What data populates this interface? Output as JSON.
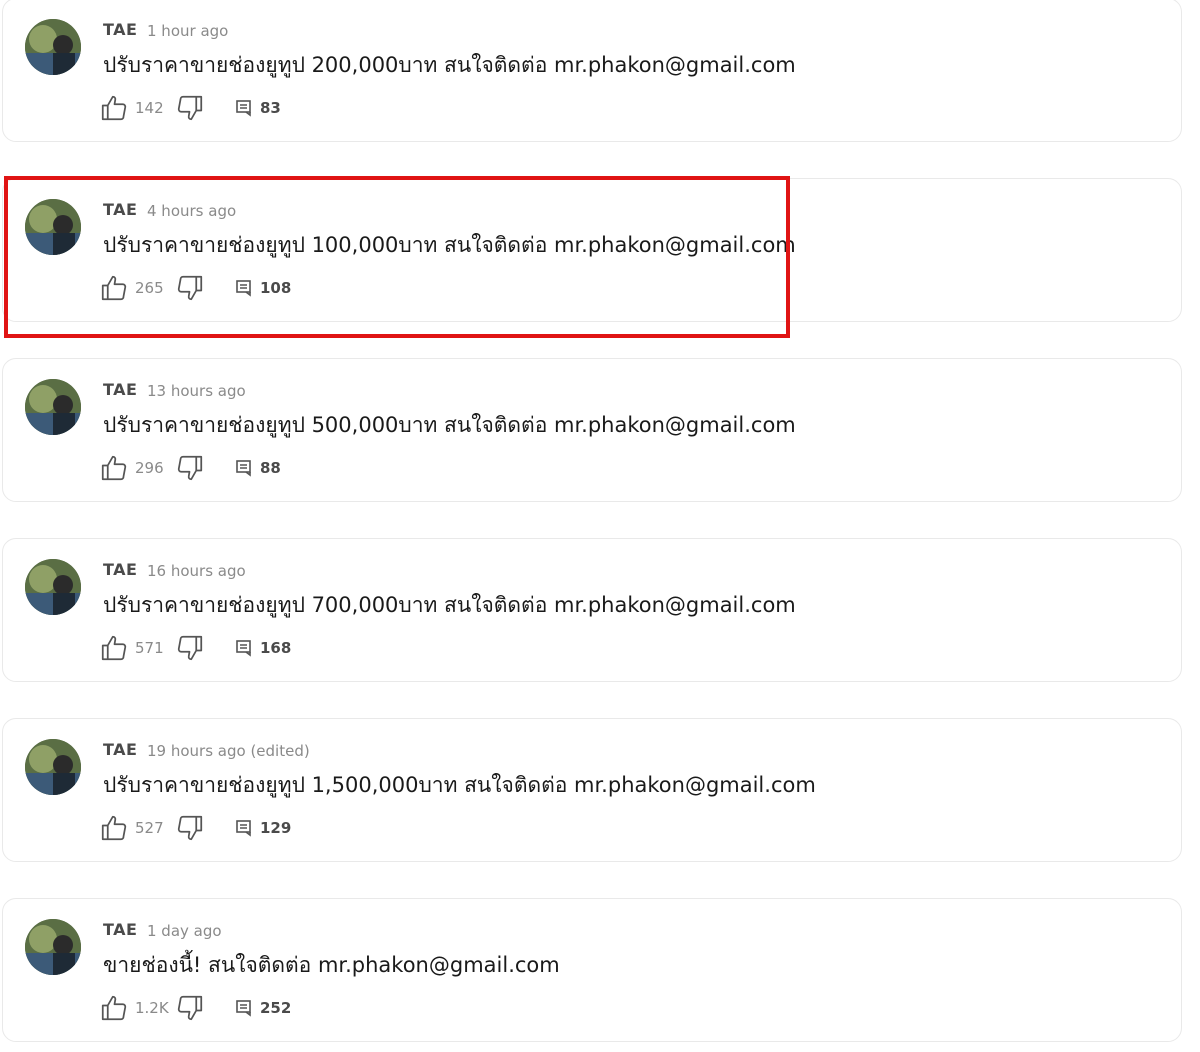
{
  "colors": {
    "highlight": "#e01414",
    "card_border": "#e9e9e9",
    "meta_text": "#8a8a8a"
  },
  "comments": [
    {
      "author": "TAE",
      "time": "1 hour ago",
      "text": "ปรับราคาขายช่องยูทูป 200,000บาท สนใจติดต่อ mr.phakon@gmail.com",
      "likes": "142",
      "replies": "83"
    },
    {
      "author": "TAE",
      "time": "4 hours ago",
      "text": "ปรับราคาขายช่องยูทูป 100,000บาท สนใจติดต่อ mr.phakon@gmail.com",
      "likes": "265",
      "replies": "108"
    },
    {
      "author": "TAE",
      "time": "13 hours ago",
      "text": "ปรับราคาขายช่องยูทูป 500,000บาท สนใจติดต่อ mr.phakon@gmail.com",
      "likes": "296",
      "replies": "88"
    },
    {
      "author": "TAE",
      "time": "16 hours ago",
      "text": "ปรับราคาขายช่องยูทูป 700,000บาท สนใจติดต่อ mr.phakon@gmail.com",
      "likes": "571",
      "replies": "168"
    },
    {
      "author": "TAE",
      "time": "19 hours ago (edited)",
      "text": "ปรับราคาขายช่องยูทูป 1,500,000บาท สนใจติดต่อ mr.phakon@gmail.com",
      "likes": "527",
      "replies": "129"
    },
    {
      "author": "TAE",
      "time": "1 day ago",
      "text": "ขายช่องนี้! สนใจติดต่อ mr.phakon@gmail.com",
      "likes": "1.2K",
      "replies": "252"
    }
  ]
}
